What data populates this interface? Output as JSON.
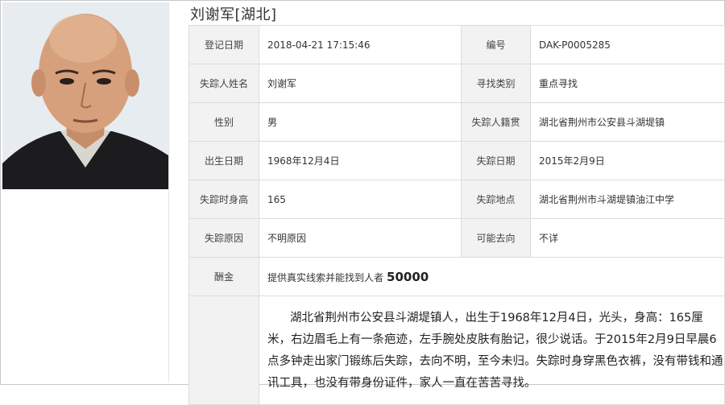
{
  "title": "刘谢军[湖北]",
  "rows": [
    {
      "l1": "登记日期",
      "v1": "2018-04-21 17:15:46",
      "l2": "编号",
      "v2": "DAK-P0005285"
    },
    {
      "l1": "失踪人姓名",
      "v1": "刘谢军",
      "l2": "寻找类别",
      "v2": "重点寻找"
    },
    {
      "l1": "性别",
      "v1": "男",
      "l2": "失踪人籍贯",
      "v2": "湖北省荆州市公安县斗湖堤镇"
    },
    {
      "l1": "出生日期",
      "v1": "1968年12月4日",
      "l2": "失踪日期",
      "v2": "2015年2月9日"
    },
    {
      "l1": "失踪时身高",
      "v1": "165",
      "l2": "失踪地点",
      "v2": "湖北省荆州市斗湖堤镇油江中学"
    },
    {
      "l1": "失踪原因",
      "v1": "不明原因",
      "l2": "可能去向",
      "v2": "不详"
    }
  ],
  "reward": {
    "label": "酬金",
    "text": "提供真实线索并能找到人者",
    "amount": "50000"
  },
  "description": "湖北省荆州市公安县斗湖堤镇人，出生于1968年12月4日，光头，身高：165厘米，右边眉毛上有一条疤迹，左手腕处皮肤有胎记，很少说话。于2015年2月9日早晨6点多钟走出家门锻练后失踪，去向不明，至今未归。失踪时身穿黑色衣裤，没有带钱和通讯工具，也没有带身份证件，家人一直在苦苦寻找。"
}
